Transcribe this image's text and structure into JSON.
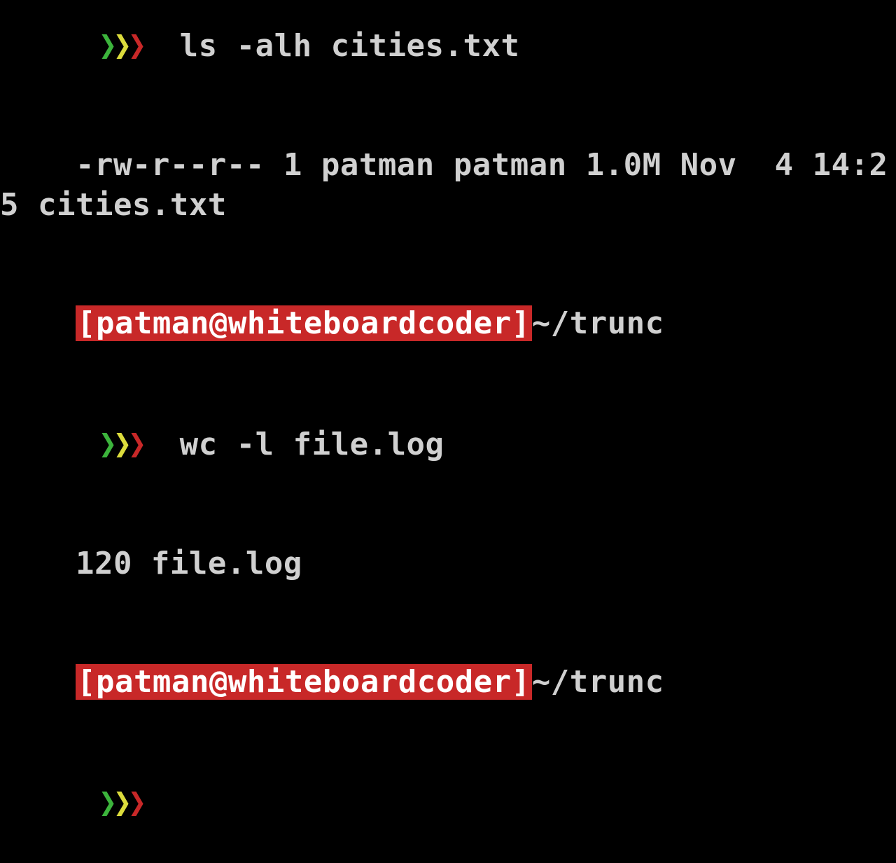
{
  "colors": {
    "bg": "#000000",
    "arrow_green": "#3cb43c",
    "arrow_yellow": "#dcdc3c",
    "arrow_red": "#c82828",
    "prompt_bg": "#c82828",
    "prompt_fg": "#ffffff",
    "text": "#d0d0d0"
  },
  "lines": [
    {
      "type": "command_partial",
      "command": "ls -alh cities.txt"
    },
    {
      "type": "output",
      "text": "-rw-r--r-- 1 patman patman 1.0M Nov  4 14:25 cities.txt"
    },
    {
      "type": "prompt_header",
      "user_host": "[patman@whiteboardcoder]",
      "path": "~/trunc"
    },
    {
      "type": "command",
      "command": "wc -l file.log"
    },
    {
      "type": "output",
      "text": "120 file.log"
    },
    {
      "type": "prompt_header",
      "user_host": "[patman@whiteboardcoder]",
      "path": "~/trunc"
    },
    {
      "type": "command",
      "command": ""
    }
  ],
  "prompt": {
    "user_host": "[patman@whiteboardcoder]",
    "path": "~/trunc",
    "arrows": "❯❯❯"
  }
}
